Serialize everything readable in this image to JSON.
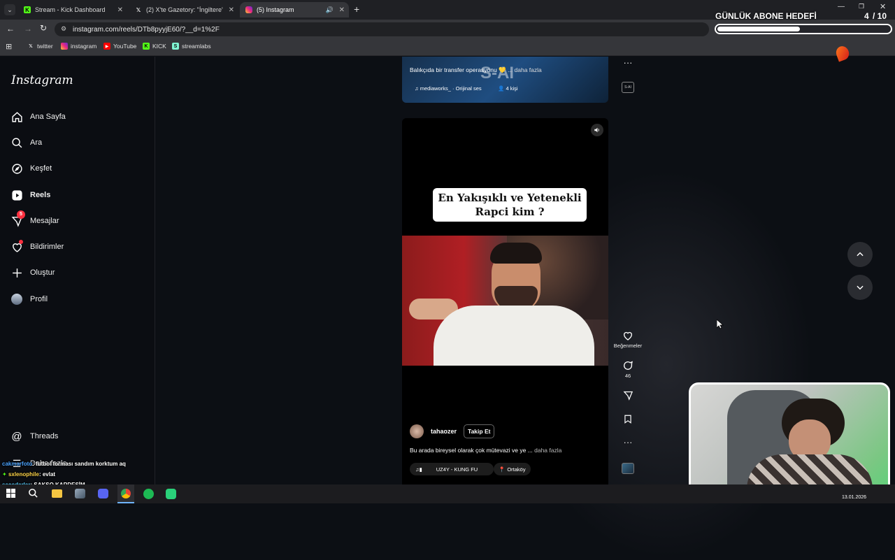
{
  "browser": {
    "tabs": [
      {
        "label": "Stream - Kick Dashboard",
        "icon": "kick-icon"
      },
      {
        "label": "(2) X'te Gazetory: \"İngiltere'den",
        "icon": "x-icon"
      },
      {
        "label": "(5) Instagram",
        "icon": "instagram-icon"
      }
    ],
    "url": "instagram.com/reels/DTb8pyyjE60/?__d=1%2F",
    "bookmarks": [
      {
        "label": "twitter"
      },
      {
        "label": "instagram"
      },
      {
        "label": "YouTube"
      },
      {
        "label": "KICK"
      },
      {
        "label": "streamlabs"
      }
    ]
  },
  "sidebar": {
    "logo": "Instagram",
    "items": [
      {
        "label": "Ana Sayfa"
      },
      {
        "label": "Ara"
      },
      {
        "label": "Keşfet"
      },
      {
        "label": "Reels"
      },
      {
        "label": "Mesajlar",
        "badge": "5"
      },
      {
        "label": "Bildirimler"
      },
      {
        "label": "Oluştur"
      },
      {
        "label": "Profil"
      },
      {
        "label": "Threads"
      },
      {
        "label": "Daha fazla"
      }
    ]
  },
  "prev_reel": {
    "caption": "Balıkçıda bir transfer operasyonu 💛",
    "more": "... daha fazla",
    "audio": "mediaworks_ · Orijinal ses",
    "people": "4 kişi",
    "watermark": "S-AI"
  },
  "reel": {
    "overlay_text_line1": "En Yakışıklı ve Yetenekli",
    "overlay_text_line2": "Rapci kim ?",
    "username": "tahaozer",
    "follow_label": "Takip Et",
    "caption": "Bu arada bireysel olarak çok mütevazi ve ye ...",
    "more": "daha fazla",
    "audio": "UZ4Y - KUNG FU",
    "location": "Ortaköy"
  },
  "actions": {
    "likes_label": "Beğenmeler",
    "comments": "46"
  },
  "overlay": {
    "goal_title": "GÜNLÜK ABONE HEDEFİ",
    "goal_count": "4",
    "goal_total": "/ 10",
    "goal_progress": 0.4
  },
  "chat": [
    {
      "user": "cakmarfoto",
      "text": ": futbol forması sandım korktum aq"
    },
    {
      "user": "sxlenophile",
      "text": ": evlat"
    },
    {
      "user": "secoderler",
      "text": ": SAKSO KARDEŞİM"
    }
  ],
  "taskbar": {
    "date": "13.01.2026"
  },
  "colors": {
    "accent_blue": "#0095f6",
    "notification_red": "#ff3040"
  }
}
